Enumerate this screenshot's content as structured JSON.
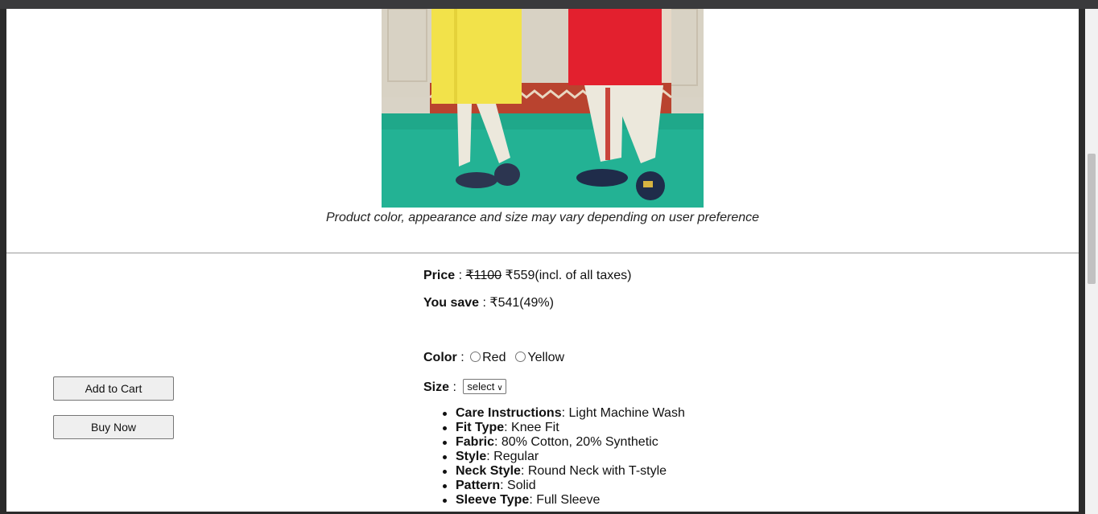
{
  "product": {
    "image_alt": "two kids in kurta pajama",
    "caption": "Product color, appearance and size may vary depending on user preference"
  },
  "actions": {
    "add_to_cart": "Add to Cart",
    "buy_now": "Buy Now"
  },
  "price": {
    "label": "Price",
    "separator": " : ",
    "original": "₹1100",
    "current": "₹559",
    "note": "(incl. of all taxes)"
  },
  "savings": {
    "label": "You save",
    "separator": " : ",
    "value": "₹541(49%)"
  },
  "color": {
    "label": "Color",
    "separator": " : ",
    "options": [
      "Red",
      "Yellow"
    ]
  },
  "size": {
    "label": "Size",
    "separator": " : ",
    "selected": "select"
  },
  "specs": [
    {
      "key": "Care Instructions",
      "value": ": Light Machine Wash"
    },
    {
      "key": "Fit Type",
      "value": ": Knee Fit"
    },
    {
      "key": "Fabric",
      "value": ": 80% Cotton, 20% Synthetic"
    },
    {
      "key": "Style",
      "value": ": Regular"
    },
    {
      "key": "Neck Style",
      "value": ": Round Neck with T-style"
    },
    {
      "key": "Pattern",
      "value": ": Solid"
    },
    {
      "key": "Sleeve Type",
      "value": ": Full Sleeve"
    }
  ],
  "colors": {
    "frame": "#2b2b2b",
    "kurta_yellow": "#f2e24a",
    "kurta_red": "#e3202e",
    "carpet": "#1fa88a"
  }
}
